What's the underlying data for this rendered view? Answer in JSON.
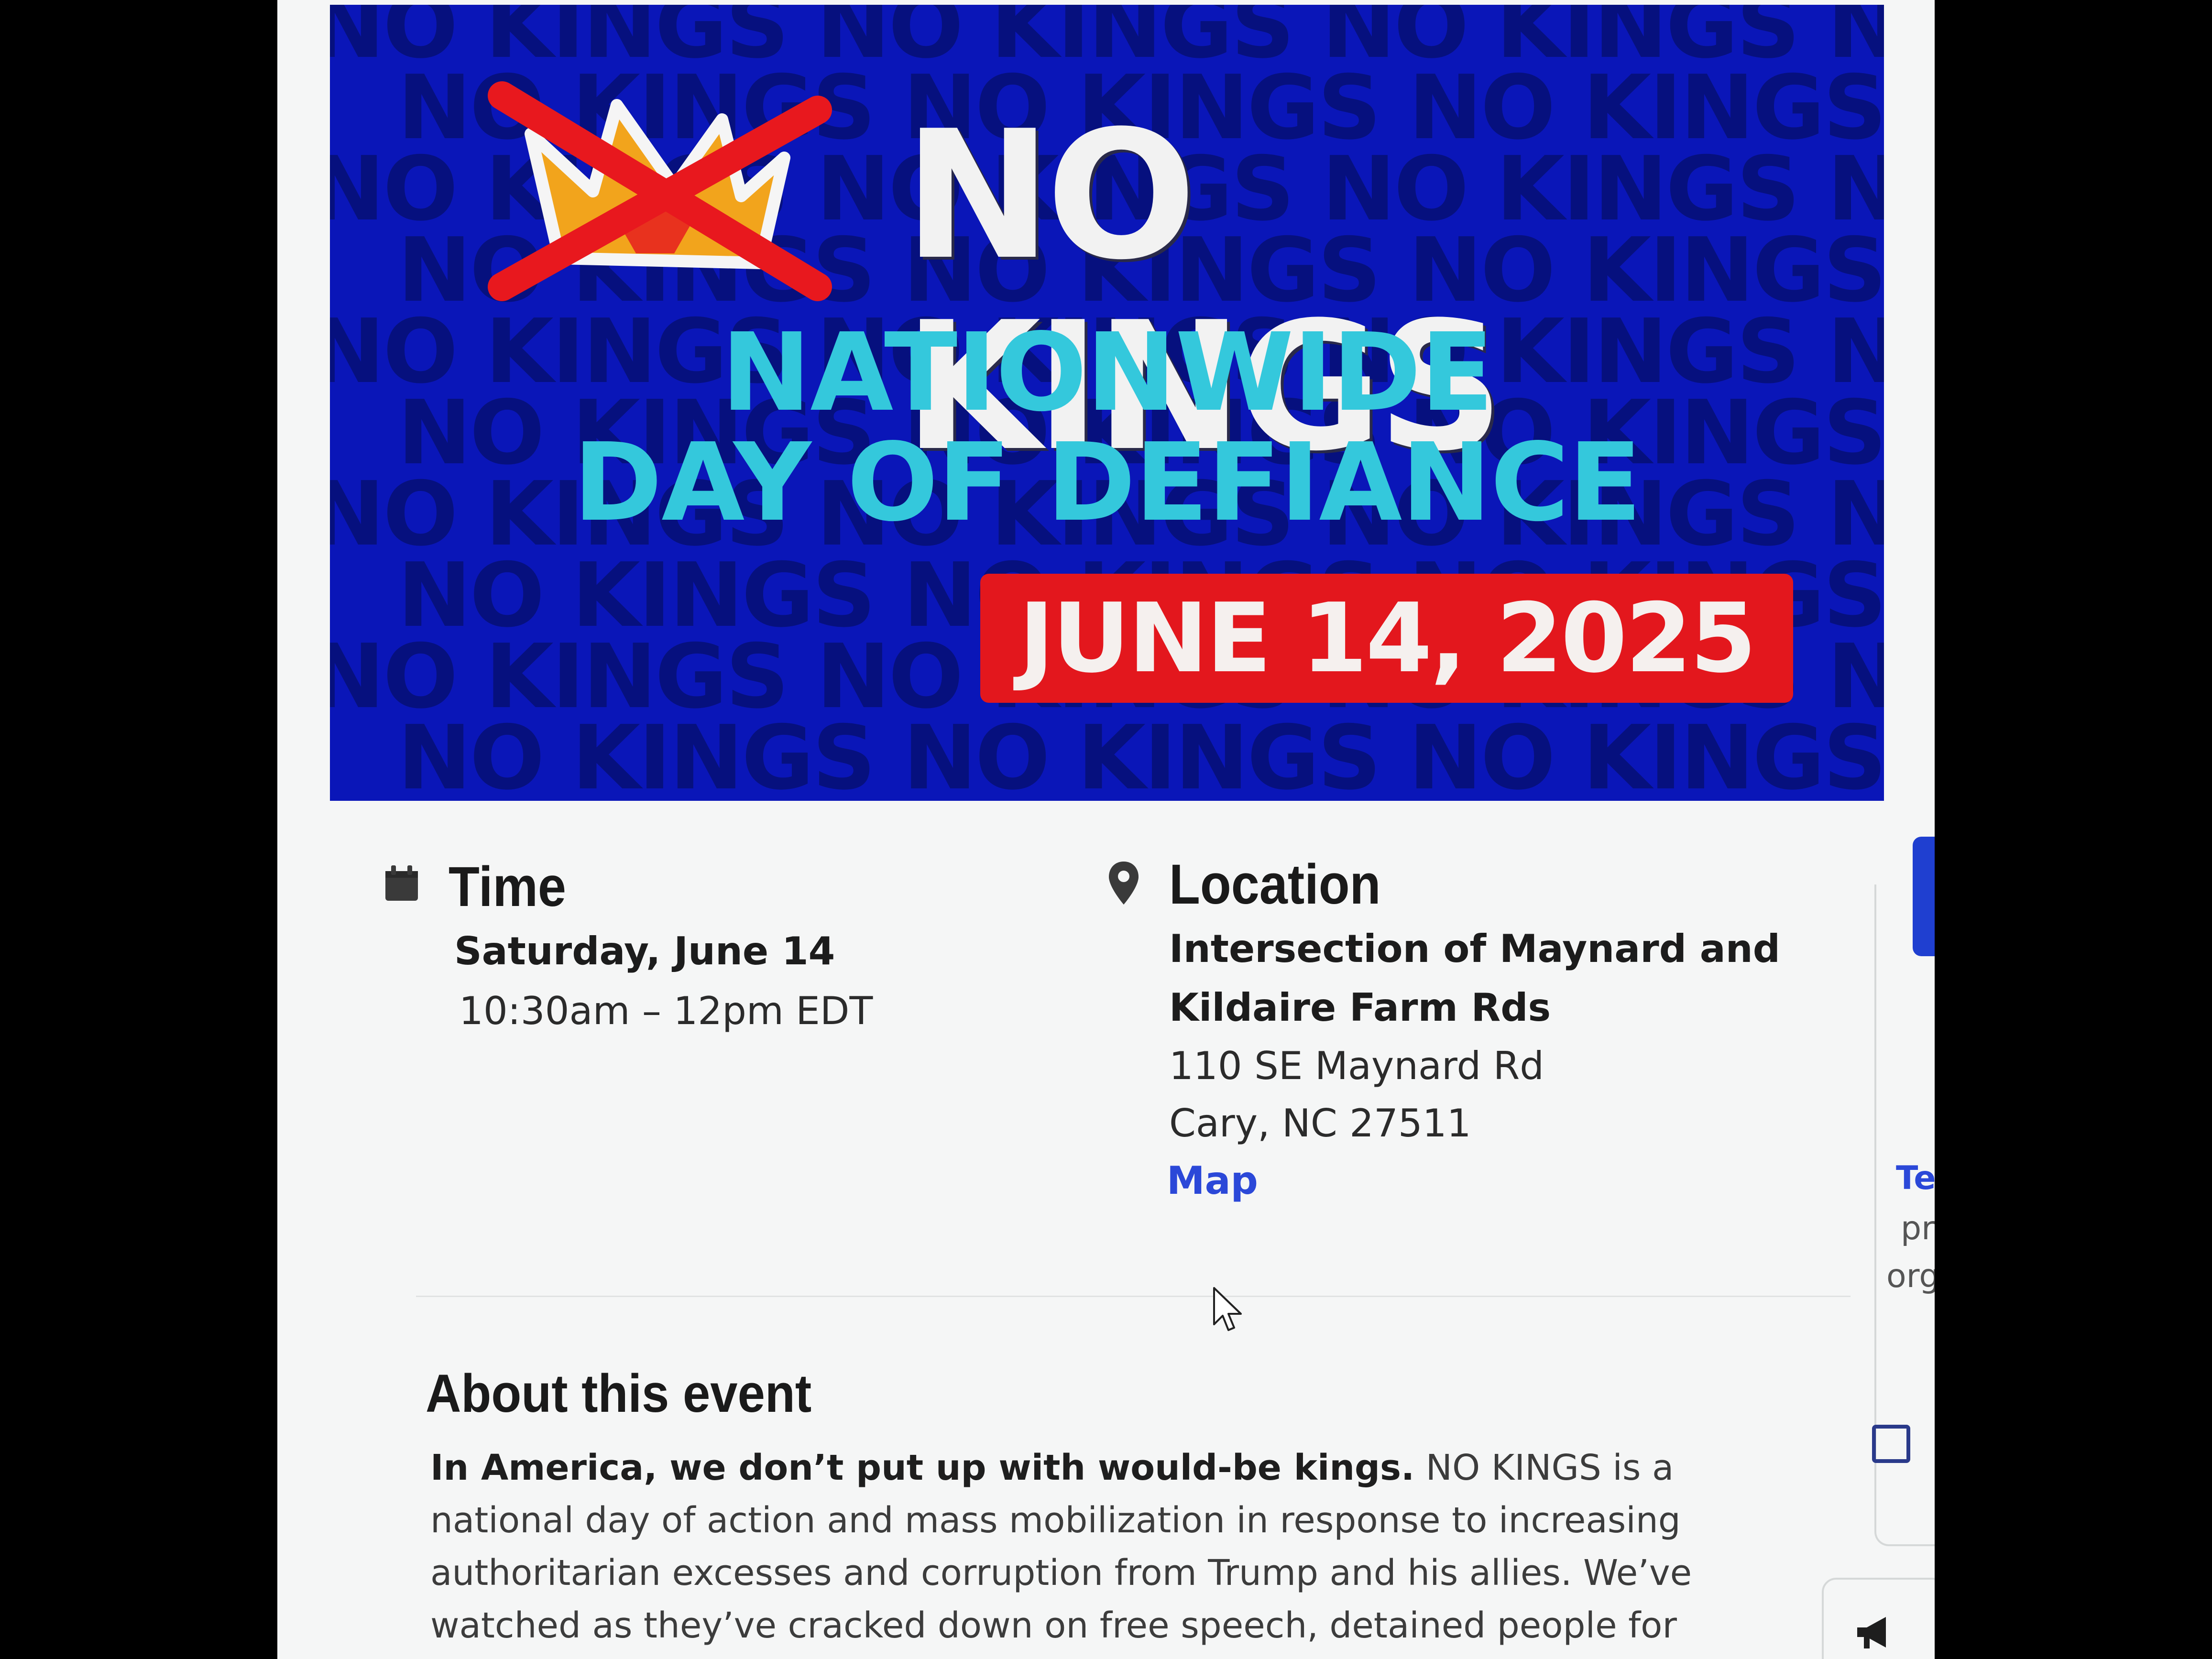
{
  "banner": {
    "background_text": "NO KINGS NO KINGS NO KINGS NO KINGS NO KINGS NO KINGS",
    "title": "NO KINGS",
    "subtitle_line1": "NATIONWIDE",
    "subtitle_line2": "DAY OF DEFIANCE",
    "date": "JUNE 14, 2025",
    "colors": {
      "background": "#0a16b8",
      "title": "#f2f2f2",
      "subtitle": "#34c8dc",
      "date_pill": "#e3171d"
    },
    "logo_icon": "crossed-out-crown-icon"
  },
  "time": {
    "icon": "calendar-icon",
    "heading": "Time",
    "date": "Saturday, June 14",
    "hours": "10:30am – 12pm EDT"
  },
  "location": {
    "icon": "map-pin-icon",
    "heading": "Location",
    "name_line1": "Intersection of Maynard and",
    "name_line2": "Kildaire Farm Rds",
    "street": "110 SE Maynard Rd",
    "city": "Cary, NC 27511",
    "map_link": "Map"
  },
  "about": {
    "heading": "About this event",
    "lead": "In America, we don’t put up with would-be kings.",
    "body": " NO KINGS is a national day of action and mass mobilization in response to increasing authoritarian excesses and corruption from Trump and his allies. We’ve watched as they’ve cracked down on free speech, detained people for their political views,"
  },
  "sidebar_partial": {
    "link_fragment": "Te",
    "text_fragment1": "pr",
    "text_fragment2": "org",
    "megaphone_icon": "megaphone-icon"
  }
}
